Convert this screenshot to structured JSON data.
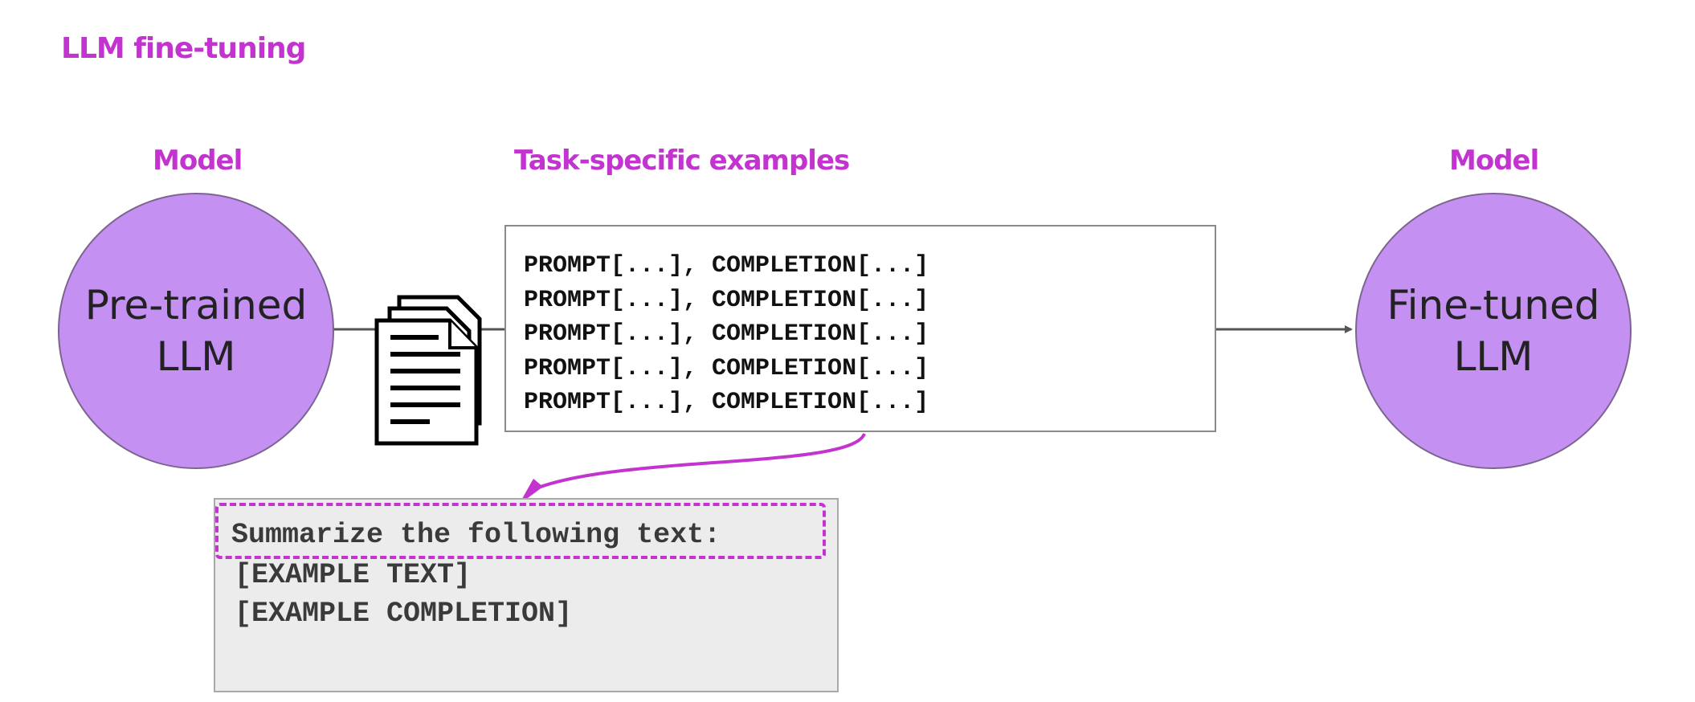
{
  "title": "LLM fine-tuning",
  "labels": {
    "model_left": "Model",
    "examples": "Task-specific examples",
    "model_right": "Model"
  },
  "models": {
    "pretrained": "Pre-trained\nLLM",
    "finetuned": "Fine-tuned\nLLM"
  },
  "examples": [
    "PROMPT[...], COMPLETION[...]",
    "PROMPT[...], COMPLETION[...]",
    "PROMPT[...], COMPLETION[...]",
    "PROMPT[...], COMPLETION[...]",
    "PROMPT[...], COMPLETION[...]"
  ],
  "detail": {
    "instruction": "Summarize the following text:",
    "lines": [
      "[EXAMPLE TEXT]",
      "[EXAMPLE COMPLETION]"
    ]
  },
  "colors": {
    "accent": "#c233d0",
    "circle_fill": "#c490f2",
    "connector": "#555555",
    "detail_bg": "#ececec"
  },
  "icons": {
    "documents": "documents-icon"
  }
}
